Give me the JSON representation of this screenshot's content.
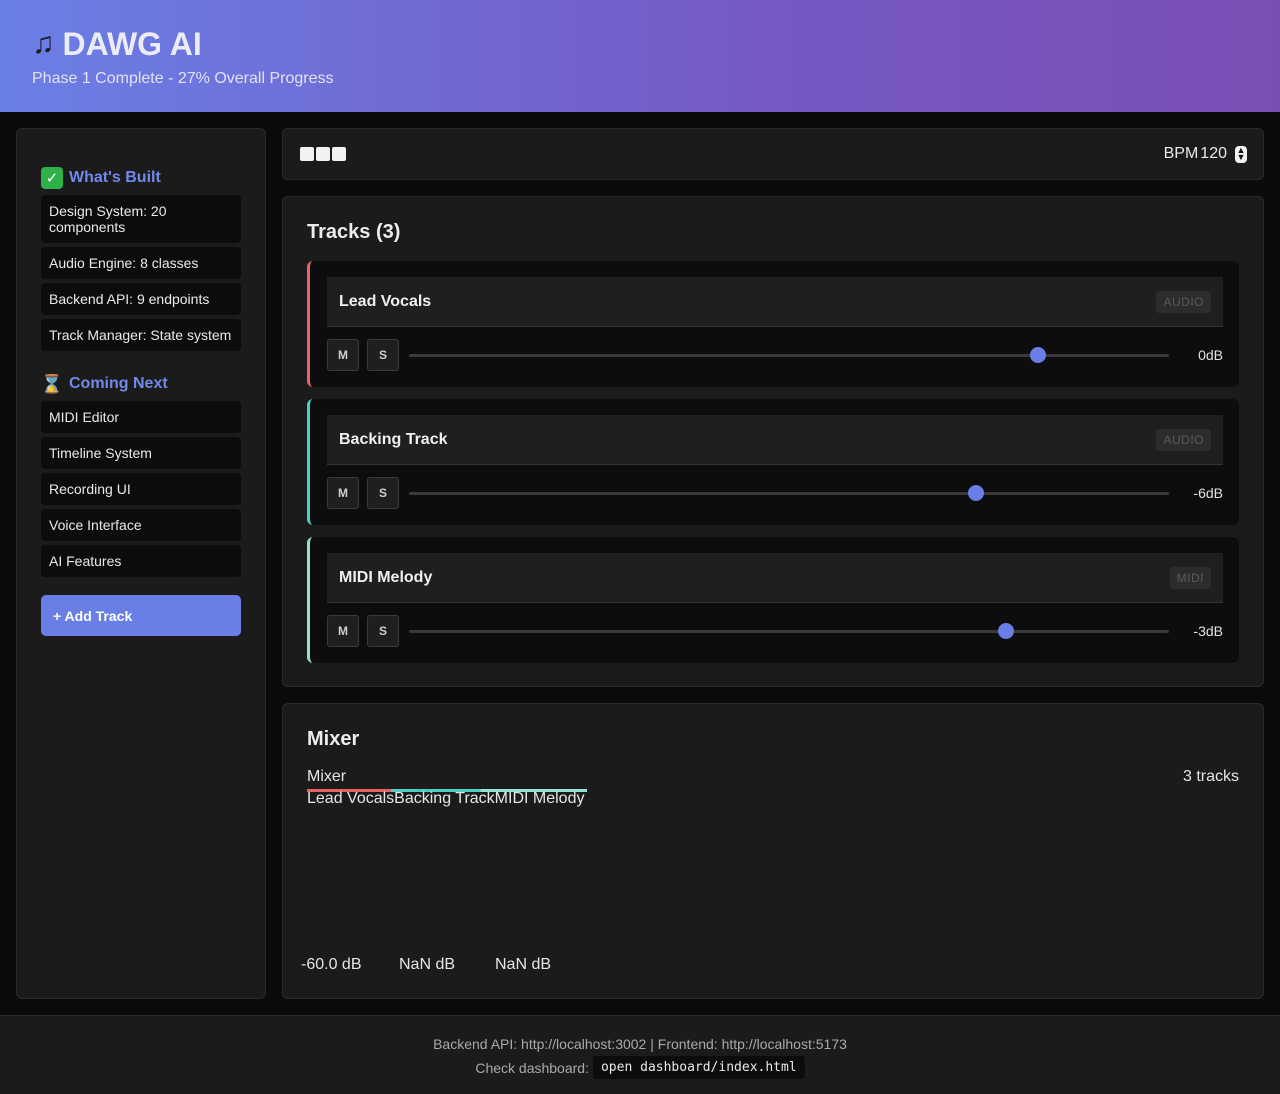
{
  "header": {
    "icon": "music-note-icon",
    "title": "DAWG AI",
    "subtitle": "Phase 1 Complete - 27% Overall Progress"
  },
  "sidebar": {
    "built": {
      "icon": "checkmark-icon",
      "title": "What's Built",
      "items": [
        "Design System: 20 components",
        "Audio Engine: 8 classes",
        "Backend API: 9 endpoints",
        "Track Manager: State system"
      ]
    },
    "next": {
      "icon": "hourglass-icon",
      "title": "Coming Next",
      "items": [
        "MIDI Editor",
        "Timeline System",
        "Recording UI",
        "Voice Interface",
        "AI Features"
      ]
    },
    "add_track_label": "+ Add Track"
  },
  "transport": {
    "bpm_label": "BPM",
    "bpm_value": "120"
  },
  "tracks": {
    "title": "Tracks (3)",
    "mute_label": "M",
    "solo_label": "S",
    "items": [
      {
        "name": "Lead Vocals",
        "type": "AUDIO",
        "volume": "0dB",
        "level": 0.827,
        "color": "#e86464"
      },
      {
        "name": "Backing Track",
        "type": "AUDIO",
        "volume": "-6dB",
        "level": 0.746,
        "color": "#4ecdc4"
      },
      {
        "name": "MIDI Melody",
        "type": "MIDI",
        "volume": "-3dB",
        "level": 0.786,
        "color": "#95e1d3"
      }
    ]
  },
  "mixer": {
    "title": "Mixer",
    "sub_label": "Mixer",
    "count": "3 tracks",
    "names": "Lead VocalsBacking TrackMIDI Melody",
    "meters": [
      "-60.0 dB",
      "NaN dB",
      "NaN dB"
    ]
  },
  "footer": {
    "line1": "Backend API: http://localhost:3002 | Frontend: http://localhost:5173",
    "check_label": "Check dashboard:",
    "command": "open dashboard/index.html"
  }
}
